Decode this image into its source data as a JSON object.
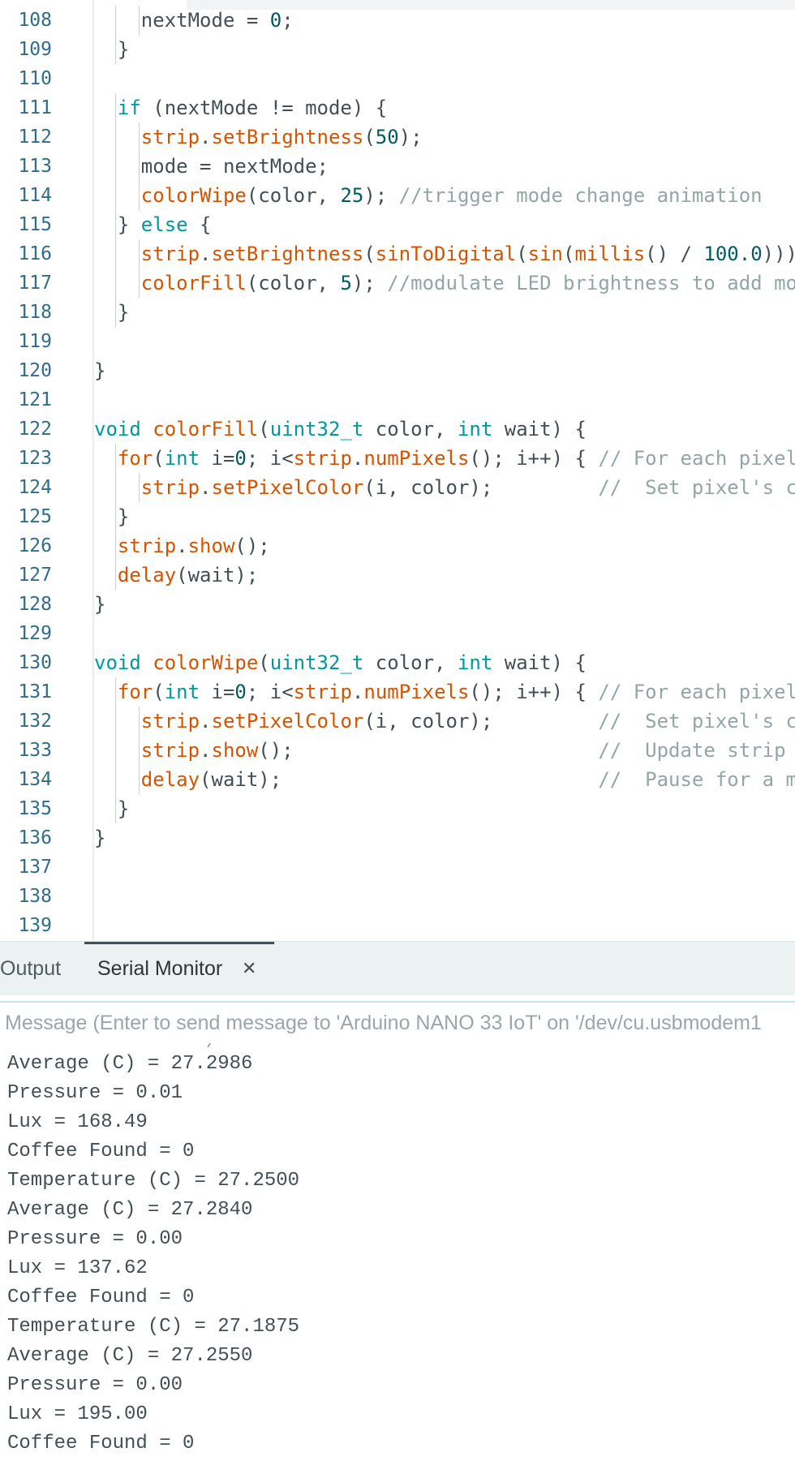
{
  "editor": {
    "lines": [
      {
        "number": "108",
        "tokens": [
          {
            "t": "nextMode = ",
            "c": "pl"
          },
          {
            "t": "0",
            "c": "num"
          },
          {
            "t": ";",
            "c": "pl"
          }
        ]
      },
      {
        "number": "109",
        "tokens": [
          {
            "t": "}",
            "c": "pl"
          }
        ]
      },
      {
        "number": "110",
        "tokens": []
      },
      {
        "number": "111",
        "tokens": [
          {
            "t": "if",
            "c": "kw"
          },
          {
            "t": " (nextMode != mode) {",
            "c": "pl"
          }
        ]
      },
      {
        "number": "112",
        "tokens": [
          {
            "t": "strip",
            "c": "fn"
          },
          {
            "t": ".",
            "c": "pl"
          },
          {
            "t": "setBrightness",
            "c": "fn"
          },
          {
            "t": "(",
            "c": "pl"
          },
          {
            "t": "50",
            "c": "num"
          },
          {
            "t": ");",
            "c": "pl"
          }
        ]
      },
      {
        "number": "113",
        "tokens": [
          {
            "t": "mode = nextMode;",
            "c": "pl"
          }
        ]
      },
      {
        "number": "114",
        "tokens": [
          {
            "t": "colorWipe",
            "c": "fn"
          },
          {
            "t": "(color, ",
            "c": "pl"
          },
          {
            "t": "25",
            "c": "num"
          },
          {
            "t": "); ",
            "c": "pl"
          },
          {
            "t": "//trigger mode change animation",
            "c": "cm"
          }
        ]
      },
      {
        "number": "115",
        "tokens": [
          {
            "t": "} ",
            "c": "pl"
          },
          {
            "t": "else",
            "c": "kw"
          },
          {
            "t": " {",
            "c": "pl"
          }
        ]
      },
      {
        "number": "116",
        "tokens": [
          {
            "t": "strip",
            "c": "fn"
          },
          {
            "t": ".",
            "c": "pl"
          },
          {
            "t": "setBrightness",
            "c": "fn"
          },
          {
            "t": "(",
            "c": "pl"
          },
          {
            "t": "sinToDigital",
            "c": "fn"
          },
          {
            "t": "(",
            "c": "pl"
          },
          {
            "t": "sin",
            "c": "fn"
          },
          {
            "t": "(",
            "c": "pl"
          },
          {
            "t": "millis",
            "c": "fn"
          },
          {
            "t": "() / ",
            "c": "pl"
          },
          {
            "t": "100.0",
            "c": "num"
          },
          {
            "t": ")))",
            "c": "pl"
          }
        ]
      },
      {
        "number": "117",
        "tokens": [
          {
            "t": "colorFill",
            "c": "fn"
          },
          {
            "t": "(color, ",
            "c": "pl"
          },
          {
            "t": "5",
            "c": "num"
          },
          {
            "t": "); ",
            "c": "pl"
          },
          {
            "t": "//modulate LED brightness to add mo",
            "c": "cm"
          }
        ]
      },
      {
        "number": "118",
        "tokens": [
          {
            "t": "}",
            "c": "pl"
          }
        ]
      },
      {
        "number": "119",
        "tokens": []
      },
      {
        "number": "120",
        "tokens": [
          {
            "t": "}",
            "c": "pl"
          }
        ]
      },
      {
        "number": "121",
        "tokens": []
      },
      {
        "number": "122",
        "tokens": [
          {
            "t": "void",
            "c": "kw"
          },
          {
            "t": " ",
            "c": "pl"
          },
          {
            "t": "colorFill",
            "c": "fn"
          },
          {
            "t": "(",
            "c": "pl"
          },
          {
            "t": "uint32_t",
            "c": "kw"
          },
          {
            "t": " color, ",
            "c": "pl"
          },
          {
            "t": "int",
            "c": "kw"
          },
          {
            "t": " wait) {",
            "c": "pl"
          }
        ]
      },
      {
        "number": "123",
        "tokens": [
          {
            "t": "for",
            "c": "fn"
          },
          {
            "t": "(",
            "c": "pl"
          },
          {
            "t": "int",
            "c": "kw"
          },
          {
            "t": " i=",
            "c": "pl"
          },
          {
            "t": "0",
            "c": "num"
          },
          {
            "t": "; i<",
            "c": "pl"
          },
          {
            "t": "strip",
            "c": "fn"
          },
          {
            "t": ".",
            "c": "pl"
          },
          {
            "t": "numPixels",
            "c": "fn"
          },
          {
            "t": "(); i++) { ",
            "c": "pl"
          },
          {
            "t": "// For each pixel",
            "c": "cm"
          }
        ]
      },
      {
        "number": "124",
        "tokens": [
          {
            "t": "strip",
            "c": "fn"
          },
          {
            "t": ".",
            "c": "pl"
          },
          {
            "t": "setPixelColor",
            "c": "fn"
          },
          {
            "t": "(i, color);         ",
            "c": "pl"
          },
          {
            "t": "//  Set pixel's c",
            "c": "cm"
          }
        ]
      },
      {
        "number": "125",
        "tokens": [
          {
            "t": "}",
            "c": "pl"
          }
        ]
      },
      {
        "number": "126",
        "tokens": [
          {
            "t": "strip",
            "c": "fn"
          },
          {
            "t": ".",
            "c": "pl"
          },
          {
            "t": "show",
            "c": "fn"
          },
          {
            "t": "();",
            "c": "pl"
          }
        ]
      },
      {
        "number": "127",
        "tokens": [
          {
            "t": "delay",
            "c": "fn"
          },
          {
            "t": "(wait);",
            "c": "pl"
          }
        ]
      },
      {
        "number": "128",
        "tokens": [
          {
            "t": "}",
            "c": "pl"
          }
        ]
      },
      {
        "number": "129",
        "tokens": []
      },
      {
        "number": "130",
        "tokens": [
          {
            "t": "void",
            "c": "kw"
          },
          {
            "t": " ",
            "c": "pl"
          },
          {
            "t": "colorWipe",
            "c": "fn"
          },
          {
            "t": "(",
            "c": "pl"
          },
          {
            "t": "uint32_t",
            "c": "kw"
          },
          {
            "t": " color, ",
            "c": "pl"
          },
          {
            "t": "int",
            "c": "kw"
          },
          {
            "t": " wait) {",
            "c": "pl"
          }
        ]
      },
      {
        "number": "131",
        "tokens": [
          {
            "t": "for",
            "c": "fn"
          },
          {
            "t": "(",
            "c": "pl"
          },
          {
            "t": "int",
            "c": "kw"
          },
          {
            "t": " i=",
            "c": "pl"
          },
          {
            "t": "0",
            "c": "num"
          },
          {
            "t": "; i<",
            "c": "pl"
          },
          {
            "t": "strip",
            "c": "fn"
          },
          {
            "t": ".",
            "c": "pl"
          },
          {
            "t": "numPixels",
            "c": "fn"
          },
          {
            "t": "(); i++) { ",
            "c": "pl"
          },
          {
            "t": "// For each pixel",
            "c": "cm"
          }
        ]
      },
      {
        "number": "132",
        "tokens": [
          {
            "t": "strip",
            "c": "fn"
          },
          {
            "t": ".",
            "c": "pl"
          },
          {
            "t": "setPixelColor",
            "c": "fn"
          },
          {
            "t": "(i, color);         ",
            "c": "pl"
          },
          {
            "t": "//  Set pixel's c",
            "c": "cm"
          }
        ]
      },
      {
        "number": "133",
        "tokens": [
          {
            "t": "strip",
            "c": "fn"
          },
          {
            "t": ".",
            "c": "pl"
          },
          {
            "t": "show",
            "c": "fn"
          },
          {
            "t": "();                          ",
            "c": "pl"
          },
          {
            "t": "//  Update strip",
            "c": "cm"
          }
        ]
      },
      {
        "number": "134",
        "tokens": [
          {
            "t": "delay",
            "c": "fn"
          },
          {
            "t": "(wait);                           ",
            "c": "pl"
          },
          {
            "t": "//  Pause for a m",
            "c": "cm"
          }
        ]
      },
      {
        "number": "135",
        "tokens": [
          {
            "t": "}",
            "c": "pl"
          }
        ]
      },
      {
        "number": "136",
        "tokens": [
          {
            "t": "}",
            "c": "pl"
          }
        ]
      },
      {
        "number": "137",
        "tokens": []
      },
      {
        "number": "138",
        "tokens": []
      },
      {
        "number": "139",
        "tokens": []
      }
    ]
  },
  "panel": {
    "tabs": [
      {
        "label": "Output",
        "active": false
      },
      {
        "label": "Serial Monitor",
        "active": true
      }
    ],
    "close_icon": "close-icon",
    "message_placeholder": "Message (Enter to send message to 'Arduino NANO 33 IoT' on '/dev/cu.usbmodem1",
    "output_lines": [
      "Average (C) = 27.2986",
      "Pressure = 0.01",
      "Lux = 168.49",
      "Coffee Found = 0",
      "Temperature (C) = 27.2500",
      "Average (C) = 27.2840",
      "Pressure = 0.00",
      "Lux = 137.62",
      "Coffee Found = 0",
      "Temperature (C) = 27.1875",
      "Average (C) = 27.2550",
      "Pressure = 0.00",
      "Lux = 195.00",
      "Coffee Found = 0"
    ]
  },
  "colors": {
    "keyword": "#00979d",
    "function": "#d35400",
    "number": "#005c5f",
    "comment": "#95a5a6",
    "plain": "#434f54",
    "line_number": "#2f6d8b"
  }
}
